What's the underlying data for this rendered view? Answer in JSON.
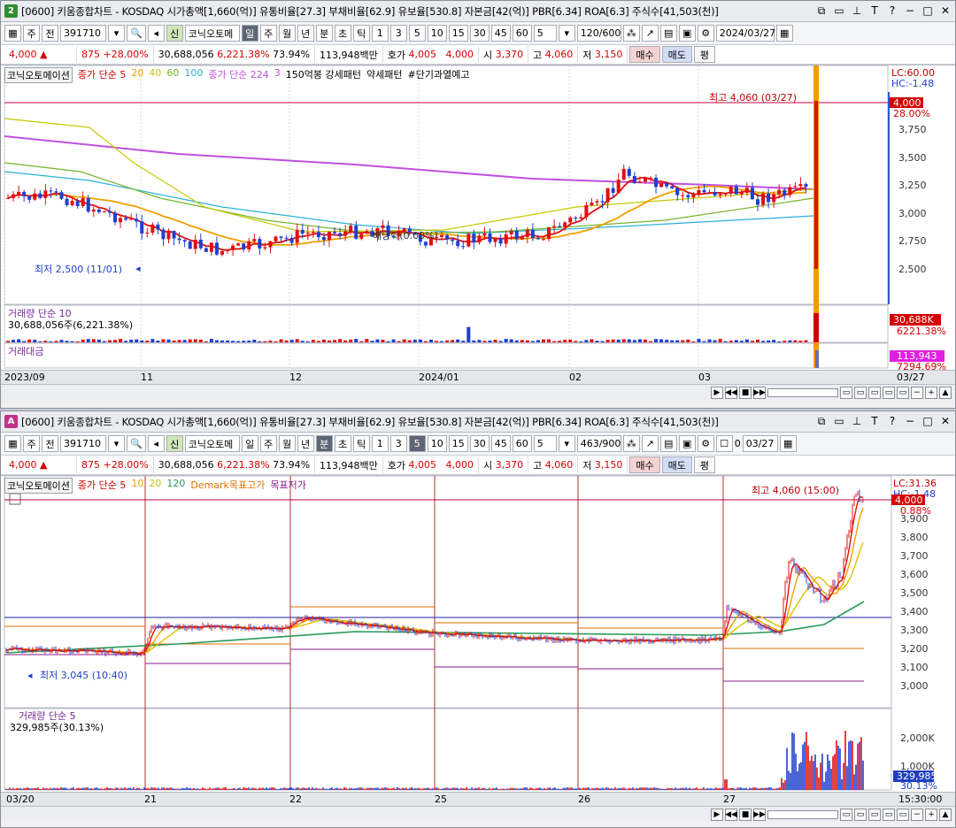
{
  "top": {
    "badge": "2",
    "badge_color": "#2f8f2f",
    "title": "[0600] 키움종합차트 - KOSDAQ 시가총액[1,660(억)] 유통비율[27.3] 부채비율[62.9] 유보율[530.8] 자본금[42(억)] PBR[6.34] ROA[6.3] 주식수[41,503(천)]",
    "toolbar": {
      "type_label": "주",
      "prev_label": "전",
      "code": "391710",
      "new_label": "신",
      "name": "코닉오토메",
      "periods": [
        "일",
        "주",
        "월",
        "년",
        "분",
        "초",
        "틱"
      ],
      "active_period": "일",
      "nums": [
        "1",
        "3",
        "5",
        "10",
        "15",
        "30",
        "45",
        "60"
      ],
      "count_sel": "5",
      "range": "120/600",
      "date": "2024/03/27"
    },
    "legend": {
      "name": "코닉오토메이션",
      "ma_label": "종가 단순 5",
      "ma_periods": [
        "20",
        "40",
        "60",
        "100"
      ],
      "ma2_label": "종가 단순 224",
      "ma2_extra": "3",
      "items": [
        "150억봉 강세패턴",
        "약세패턴",
        "#단기과열예고"
      ]
    },
    "annotations": {
      "high": "최고 4,060 (03/27)",
      "low": "최저 2,500 (11/01)",
      "dividend": "배당락(0.00%)"
    },
    "yaxis": {
      "lc": "LC:60.00",
      "hc": "HC:-1.48",
      "ticks": [
        "3,750",
        "3,500",
        "3,250",
        "3,000",
        "2,750",
        "2,500"
      ],
      "last": "4,000",
      "pct": "28.00%"
    },
    "volume": {
      "title": "거래량 단순 10",
      "value_text": "30,688,056주(6,221.38%)",
      "tag": "30,688K",
      "pct": "6221.38%"
    },
    "amount": {
      "title": "거래대금",
      "tag": "113,943",
      "pct": "7294.69%"
    },
    "xaxis": [
      "2023/09",
      "11",
      "12",
      "2024/01",
      "02",
      "03"
    ],
    "xaxis_right": "03/27"
  },
  "quote": {
    "price": "4,000",
    "arrow": "▲",
    "change": "875",
    "change_pct": "+28.00%",
    "volume": "30,688,056",
    "vol_pct": "6,221.38%",
    "turnover": "73.94%",
    "amount": "113,948백만",
    "hoga_label": "호가",
    "ask": "4,005",
    "bid": "4,000",
    "open_label": "시",
    "open": "3,370",
    "high_label": "고",
    "high": "4,060",
    "low_label": "저",
    "low": "3,150",
    "buy": "매수",
    "sell": "매도",
    "eval": "평"
  },
  "bottom": {
    "badge": "A",
    "badge_color": "#c0338c",
    "title": "[0600] 키움종합차트 - KOSDAQ 시가총액[1,660(억)] 유통비율[27.3] 부채비율[62.9] 유보율[530.8] 자본금[42(억)] PBR[6.34] ROA[6.3] 주식수[41,503(천)]",
    "toolbar": {
      "type_label": "주",
      "prev_label": "전",
      "code": "391710",
      "new_label": "신",
      "name": "코닉오토메",
      "periods": [
        "일",
        "주",
        "월",
        "년",
        "분",
        "초",
        "틱"
      ],
      "active_period": "분",
      "nums": [
        "1",
        "3",
        "5",
        "10",
        "15",
        "30",
        "45",
        "60"
      ],
      "active_num": "5",
      "count_sel": "5",
      "range": "463/900",
      "check_label": "0",
      "date": "03/27"
    },
    "legend": {
      "name": "코닉오토메이션",
      "ma_label": "종가 단순 5",
      "ma_periods": [
        "10",
        "20",
        "120"
      ],
      "demark": "Demark목표고가",
      "demark2": "목표저가"
    },
    "annotations": {
      "high": "최고 4,060 (15:00)",
      "low": "최저 3,045 (10:40)"
    },
    "yaxis": {
      "lc": "LC:31.36",
      "hc": "HC:-1.48",
      "ticks": [
        "3,900",
        "3,800",
        "3,700",
        "3,600",
        "3,500",
        "3,400",
        "3,300",
        "3,200",
        "3,100",
        "3,000"
      ],
      "last": "4,000",
      "pct": "0.88%"
    },
    "volume": {
      "title": "거래량 단순 5",
      "value_text": "329,985주(30.13%)",
      "ticks": [
        "2,000K",
        "1,000K"
      ],
      "tag": "329,985",
      "pct": "30.13%"
    },
    "xaxis": [
      "03/20",
      "21",
      "22",
      "25",
      "26",
      "27"
    ],
    "xaxis_right": "15:30:00"
  },
  "colors": {
    "up": "#e01010",
    "down": "#1f3fd0",
    "ma5": "#e01010",
    "ma20": "#f0a000",
    "ma40": "#c8c800",
    "ma60": "#74b52a",
    "ma100": "#2ab0d8",
    "ma224": "#c050e0"
  }
}
